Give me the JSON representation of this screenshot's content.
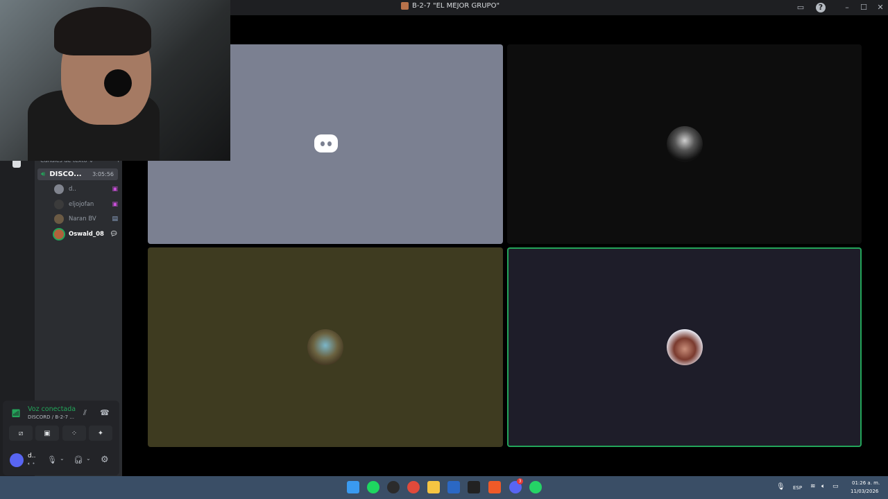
{
  "window": {
    "title": "B-2-7 \"EL MEJOR GRUPO\""
  },
  "sidebar": {
    "category_label": "Canales de texto",
    "voice_channel": {
      "name": "DISCO...",
      "elapsed": "3:05:56"
    },
    "members": [
      {
        "name": "d..",
        "avatar_color": "#5865f2",
        "bold": false
      },
      {
        "name": "eljojofan",
        "avatar_color": "#3b3b3b",
        "bold": false
      },
      {
        "name": "Naran BV",
        "avatar_color": "#6b5a44",
        "bold": false
      },
      {
        "name": "Oswald_08",
        "avatar_color": "#b0613b",
        "bold": true
      }
    ]
  },
  "voice_panel": {
    "status": "Voz conectada",
    "location": "DISCORD / B-2-7 ..."
  },
  "user_panel": {
    "name": "d.."
  },
  "tiles": [
    {
      "bg": "#7b8091",
      "avatar_color": "#ffffff",
      "icon": "discord-logo-icon",
      "speaking": false
    },
    {
      "bg": "#0d0d0d",
      "avatar_color": "#2a2a2a",
      "icon": "user-avatar-icon",
      "speaking": false
    },
    {
      "bg": "#3e3b20",
      "avatar_color": "#6b6240",
      "icon": "user-avatar-icon",
      "speaking": false
    },
    {
      "bg": "#1e1d29",
      "avatar_color": "#d9d9e8",
      "icon": "user-avatar-icon",
      "speaking": true
    }
  ],
  "colors": {
    "speaking_ring": "#23a55a",
    "voice_connected": "#23a55a",
    "discord_blurple": "#5865f2"
  },
  "taskbar": {
    "apps": [
      "windows-start-icon",
      "spotify-icon",
      "obs-icon",
      "red-app-icon",
      "file-explorer-icon",
      "word-icon",
      "app-icon",
      "brave-icon",
      "discord-icon",
      "whatsapp-icon"
    ],
    "discord_badge": "3",
    "language": "ESP",
    "time": "01:26 a. m.",
    "date": "11/03/2026"
  }
}
